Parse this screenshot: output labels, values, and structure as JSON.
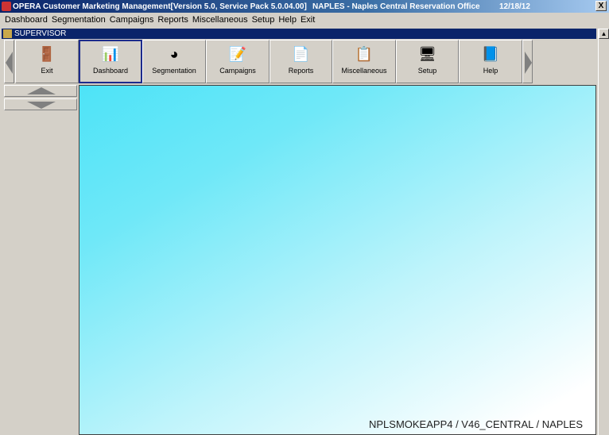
{
  "titlebar": {
    "title": "OPERA Customer Marketing Management[Version 5.0, Service Pack 5.0.04.00]",
    "property": "NAPLES - Naples Central Reservation Office",
    "date": "12/18/12",
    "close": "X"
  },
  "menu": [
    "Dashboard",
    "Segmentation",
    "Campaigns",
    "Reports",
    "Miscellaneous",
    "Setup",
    "Help",
    "Exit"
  ],
  "user_bar": "SUPERVISOR",
  "toolbar": [
    {
      "label": "Exit",
      "icon": "exit-door-icon",
      "selected": false
    },
    {
      "label": "Dashboard",
      "icon": "dashboard-chart-icon",
      "selected": true
    },
    {
      "label": "Segmentation",
      "icon": "pie-chart-icon",
      "selected": false
    },
    {
      "label": "Campaigns",
      "icon": "campaign-document-icon",
      "selected": false
    },
    {
      "label": "Reports",
      "icon": "report-icon",
      "selected": false
    },
    {
      "label": "Miscellaneous",
      "icon": "clipboard-icon",
      "selected": false
    },
    {
      "label": "Setup",
      "icon": "setup-computer-icon",
      "selected": false
    },
    {
      "label": "Help",
      "icon": "help-book-icon",
      "selected": false
    }
  ],
  "footer": "NPLSMOKEAPP4 / V46_CENTRAL / NAPLES"
}
